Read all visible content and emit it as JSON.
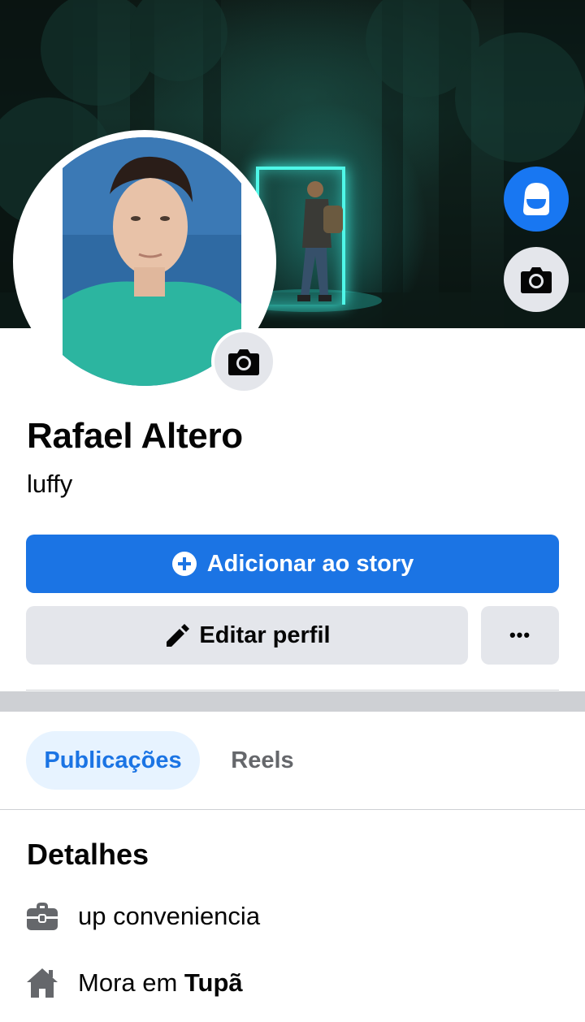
{
  "profile": {
    "name": "Rafael Altero",
    "bio": "luffy"
  },
  "actions": {
    "add_story_label": "Adicionar ao story",
    "edit_profile_label": "Editar perfil",
    "more_label": "•••"
  },
  "tabs": [
    {
      "label": "Publicações",
      "selected": true
    },
    {
      "label": "Reels",
      "selected": false
    }
  ],
  "details": {
    "title": "Detalhes",
    "work": "up conveniencia",
    "home_prefix": "Mora em ",
    "home_city": "Tupã"
  },
  "colors": {
    "primary": "#1b74e4",
    "secondary_button": "#e4e6eb",
    "tab_selected_bg": "#e7f3ff",
    "separator": "#ced0d4",
    "muted_text": "#65676b"
  },
  "icons": {
    "avatar_button": "avatar-icon",
    "cover_camera": "camera-icon",
    "profile_camera": "camera-icon",
    "add_story": "plus-circle-icon",
    "edit": "pencil-icon",
    "more": "ellipsis-icon",
    "work": "briefcase-icon",
    "home": "house-icon"
  }
}
